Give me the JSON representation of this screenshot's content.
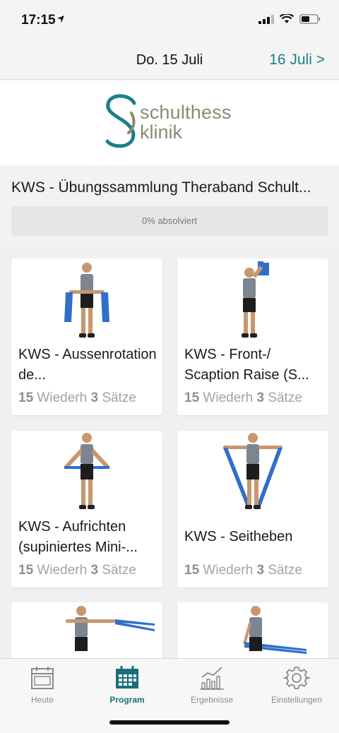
{
  "status_bar": {
    "time": "17:15"
  },
  "date_nav": {
    "current": "Do. 15 Juli",
    "next": "16 Juli >"
  },
  "logo": {
    "line1": "schulthess",
    "line2": "klinik"
  },
  "program": {
    "title": "KWS - Übungssammlung Theraband Schult...",
    "progress_label": "0% absolviert",
    "progress_fraction": 0
  },
  "exercises": [
    {
      "title": "KWS - Aussenrotation de...",
      "reps": "15",
      "reps_unit": "Wiederh",
      "sets": "3",
      "sets_unit": "Sätze"
    },
    {
      "title": "KWS - Front-/ Scaption Raise (S...",
      "reps": "15",
      "reps_unit": "Wiederh",
      "sets": "3",
      "sets_unit": "Sätze"
    },
    {
      "title": "KWS - Aufrichten (supiniertes Mini-...",
      "reps": "15",
      "reps_unit": "Wiederh",
      "sets": "3",
      "sets_unit": "Sätze"
    },
    {
      "title": "KWS - Seitheben",
      "reps": "15",
      "reps_unit": "Wiederh",
      "sets": "3",
      "sets_unit": "Sätze"
    }
  ],
  "tabs": [
    {
      "label": "Heute",
      "icon": "calendar-icon"
    },
    {
      "label": "Program",
      "icon": "program-calendar-icon"
    },
    {
      "label": "Ergebnisse",
      "icon": "chart-icon"
    },
    {
      "label": "Einstellungen",
      "icon": "gear-icon"
    }
  ],
  "colors": {
    "accent": "#1c7f8a",
    "logo_text": "#8d8a72",
    "band": "#2f6fc9"
  }
}
